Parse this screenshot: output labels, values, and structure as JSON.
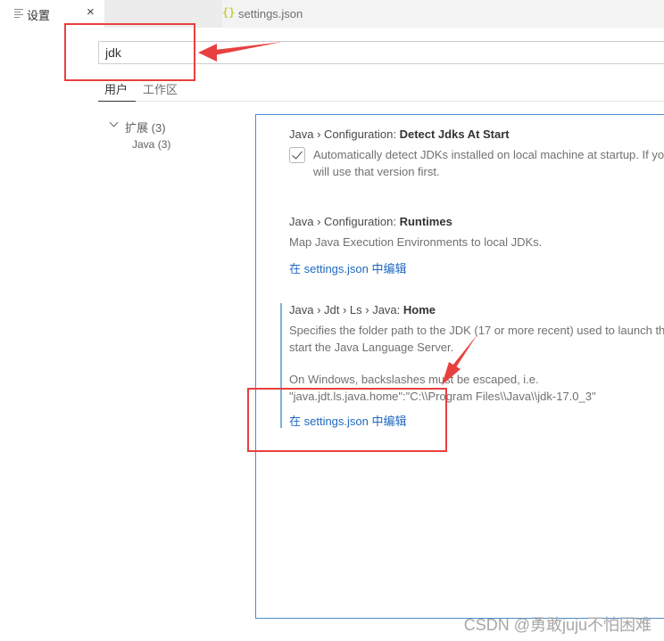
{
  "tabs": [
    {
      "label": "设置",
      "icon": "settings-menu-icon",
      "close": "×"
    },
    {
      "label": "settings.json",
      "icon": "{}"
    }
  ],
  "search": {
    "value": "jdk"
  },
  "scope_tabs": [
    "用户",
    "工作区"
  ],
  "toc": {
    "group": "扩展",
    "group_count": "(3)",
    "item": "Java",
    "item_count": "(3)"
  },
  "settings": [
    {
      "breadcrumb": "Java › Configuration: ",
      "name": "Detect Jdks At Start",
      "description_lines": [
        "Automatically detect JDKs installed on local machine at startup. If you",
        "will use that version first."
      ],
      "checked": true
    },
    {
      "breadcrumb": "Java › Configuration: ",
      "name": "Runtimes",
      "description_lines": [
        "Map Java Execution Environments to local JDKs."
      ],
      "link": "在 settings.json 中编辑"
    },
    {
      "breadcrumb": "Java › Jdt › Ls › Java: ",
      "name": "Home",
      "description_lines": [
        "Specifies the folder path to the JDK (17 or more recent) used to launch the",
        "start the Java Language Server.",
        "",
        "On Windows, backslashes must be escaped, i.e.",
        "\"java.jdt.ls.java.home\":\"C:\\\\Program Files\\\\Java\\\\jdk-17.0_3\""
      ],
      "link": "在 settings.json 中编辑"
    }
  ],
  "watermark": "CSDN @勇敢juju不怕困难",
  "colors": {
    "annotation": "#e8403f",
    "link": "#1f69c0",
    "focus": "#4a8ccc"
  }
}
